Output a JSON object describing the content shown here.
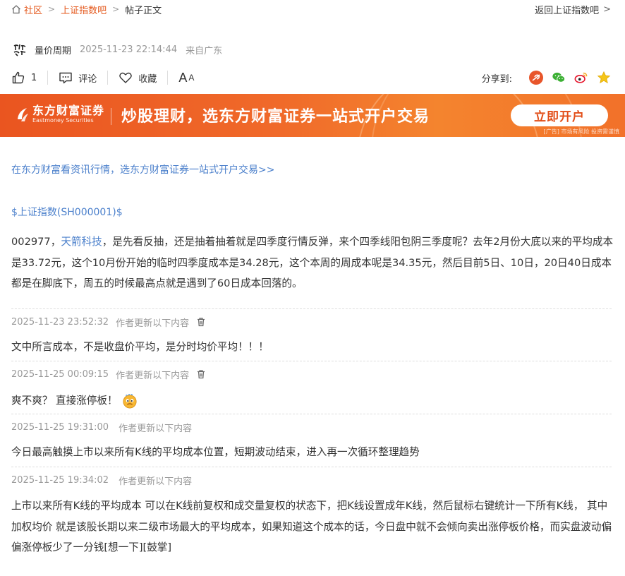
{
  "breadcrumb": {
    "home": "社区",
    "bar": "上证指数吧",
    "current": "帖子正文"
  },
  "back_link": "返回上证指数吧",
  "author": {
    "name": "量价周期",
    "time": "2025-11-23 22:14:44",
    "location": "来自广东"
  },
  "actions": {
    "like_count": "1",
    "comment": "评论",
    "favorite": "收藏",
    "font_big": "A",
    "font_small": "A"
  },
  "share": {
    "label": "分享到:",
    "icons": [
      "weibo-tencent-icon",
      "wechat-icon",
      "sina-weibo-icon",
      "favorite-star-icon"
    ]
  },
  "banner": {
    "logo_cn": "东方财富证券",
    "logo_en": "Eastmoney Securities",
    "slogan": "炒股理财，选东方财富证券一站式开户交易",
    "button": "立即开户",
    "disclaimer": "[广告] 市场有风险 投资需谨慎"
  },
  "promo_link": "在东方财富看资讯行情，选东方财富证券一站式开户交易>>",
  "stock_tag": "$上证指数(SH000001)$",
  "post": {
    "code": "002977，",
    "stock_name": "天箭科技",
    "text": "，是先看反抽，还是抽着抽着就是四季度行情反弹，来个四季线阳包阴三季度呢？去年2月份大底以来的平均成本是33.72元，这个10月份开始的临时四季度成本是34.28元，这个本周的周成本呢是34.35元，然后目前5日、10日，20日40日成本都是在脚底下，周五的时候最高点就是遇到了60日成本回落的。"
  },
  "updates": [
    {
      "time": "2025-11-23 23:52:32",
      "by": "作者更新以下内容",
      "text": "文中所言成本，不是收盘价平均，是分时均价平均！！！"
    },
    {
      "time": "2025-11-25 00:09:15",
      "by": "作者更新以下内容",
      "text": "爽不爽？ 直接涨停板！"
    },
    {
      "time": "2025-11-25 19:31:00",
      "by": "作者更新以下内容",
      "text": "今日最高触摸上市以来所有K线的平均成本位置，短期波动结束，进入再一次循环整理趋势"
    },
    {
      "time": "2025-11-25 19:34:02",
      "by": "作者更新以下内容",
      "text": "上市以来所有K线的平均成本 可以在K线前复权和成交量复权的状态下，把K线设置成年K线，然后鼠标右键统计一下所有K线， 其中 加权均价 就是该股长期以来二级市场最大的平均成本，如果知道这个成本的话，今日盘中就不会倾向卖出涨停板价格，而实盘波动偏偏涨停板少了一分钱[想一下][鼓掌]"
    }
  ],
  "colors": {
    "accent": "#e4581c",
    "link": "#4a7fcb",
    "meta": "#999999"
  }
}
